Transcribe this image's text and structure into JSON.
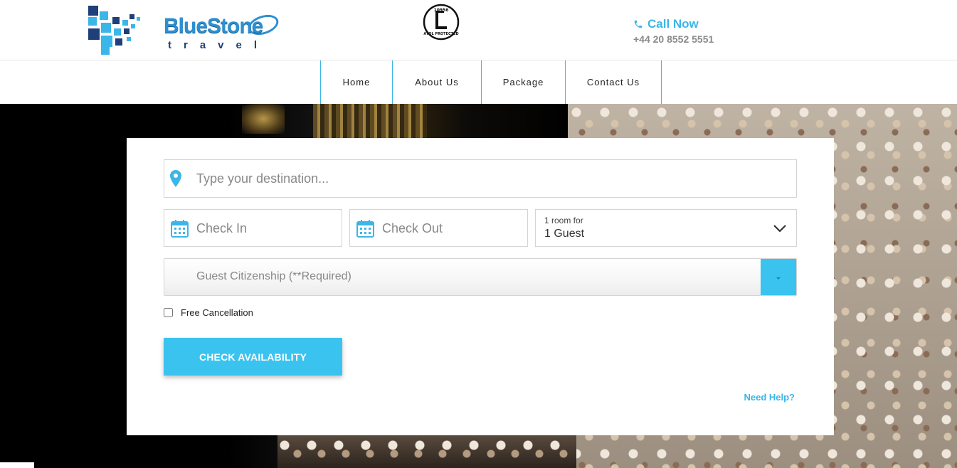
{
  "header": {
    "logo": {
      "brand_word": "BlueStone",
      "brand_sub": "travel"
    },
    "atol_badge": {
      "number": "10956",
      "text": "ATOL PROTECTED"
    },
    "call": {
      "title": "Call Now",
      "phone": "+44 20 8552 5551"
    }
  },
  "nav": {
    "items": [
      {
        "label": "Home"
      },
      {
        "label": "About Us"
      },
      {
        "label": "Package"
      },
      {
        "label": "Contact Us"
      }
    ]
  },
  "search": {
    "destination_placeholder": "Type your destination...",
    "checkin_placeholder": "Check In",
    "checkout_placeholder": "Check Out",
    "rooms_label": "1 room for",
    "rooms_value": "1 Guest",
    "citizenship_placeholder": "Guest Citizenship (**Required)",
    "free_cancellation_label": "Free Cancellation",
    "free_cancellation_checked": false,
    "check_button": "CHECK AVAILABILITY",
    "help_link": "Need Help?"
  },
  "colors": {
    "accent": "#3bc3f0",
    "link": "#3bb6e8",
    "brand_blue": "#2d8fd0",
    "brand_navy": "#1f3f7a"
  }
}
